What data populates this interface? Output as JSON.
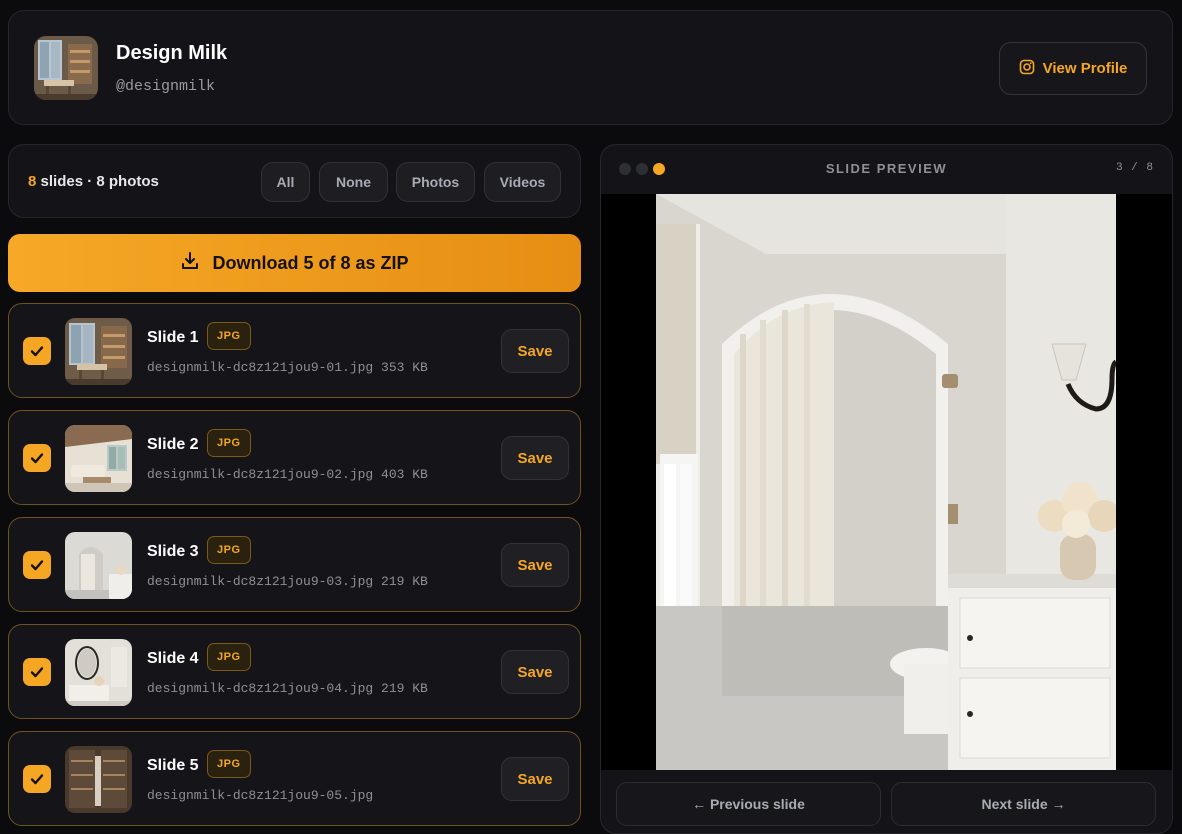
{
  "profile": {
    "name": "Design Milk",
    "handle": "@designmilk",
    "view_profile_label": "View Profile"
  },
  "filters": {
    "count_prefix": "8",
    "count_suffix": "slides · 8 photos",
    "buttons": [
      "All",
      "None",
      "Photos",
      "Videos"
    ]
  },
  "download": {
    "label": "Download 5 of 8 as ZIP"
  },
  "slides": [
    {
      "title": "Slide 1",
      "type": "JPG",
      "filename": "designmilk-dc8z121jou9-01.jpg 353 KB",
      "save": "Save",
      "checked": true
    },
    {
      "title": "Slide 2",
      "type": "JPG",
      "filename": "designmilk-dc8z121jou9-02.jpg 403 KB",
      "save": "Save",
      "checked": true
    },
    {
      "title": "Slide 3",
      "type": "JPG",
      "filename": "designmilk-dc8z121jou9-03.jpg 219 KB",
      "save": "Save",
      "checked": true
    },
    {
      "title": "Slide 4",
      "type": "JPG",
      "filename": "designmilk-dc8z121jou9-04.jpg 219 KB",
      "save": "Save",
      "checked": true
    },
    {
      "title": "Slide 5",
      "type": "JPG",
      "filename": "designmilk-dc8z121jou9-05.jpg",
      "save": "Save",
      "checked": true
    }
  ],
  "preview": {
    "label": "SLIDE PREVIEW",
    "counter": "3 / 8",
    "prev_label": "← Previous slide",
    "next_label": "Next slide →"
  },
  "colors": {
    "accent": "#f5a623",
    "background": "#0b0b0d",
    "card": "#141418"
  },
  "icons": {
    "view_profile": "instagram-icon",
    "download": "download-icon",
    "checkbox": "checkmark-icon"
  }
}
